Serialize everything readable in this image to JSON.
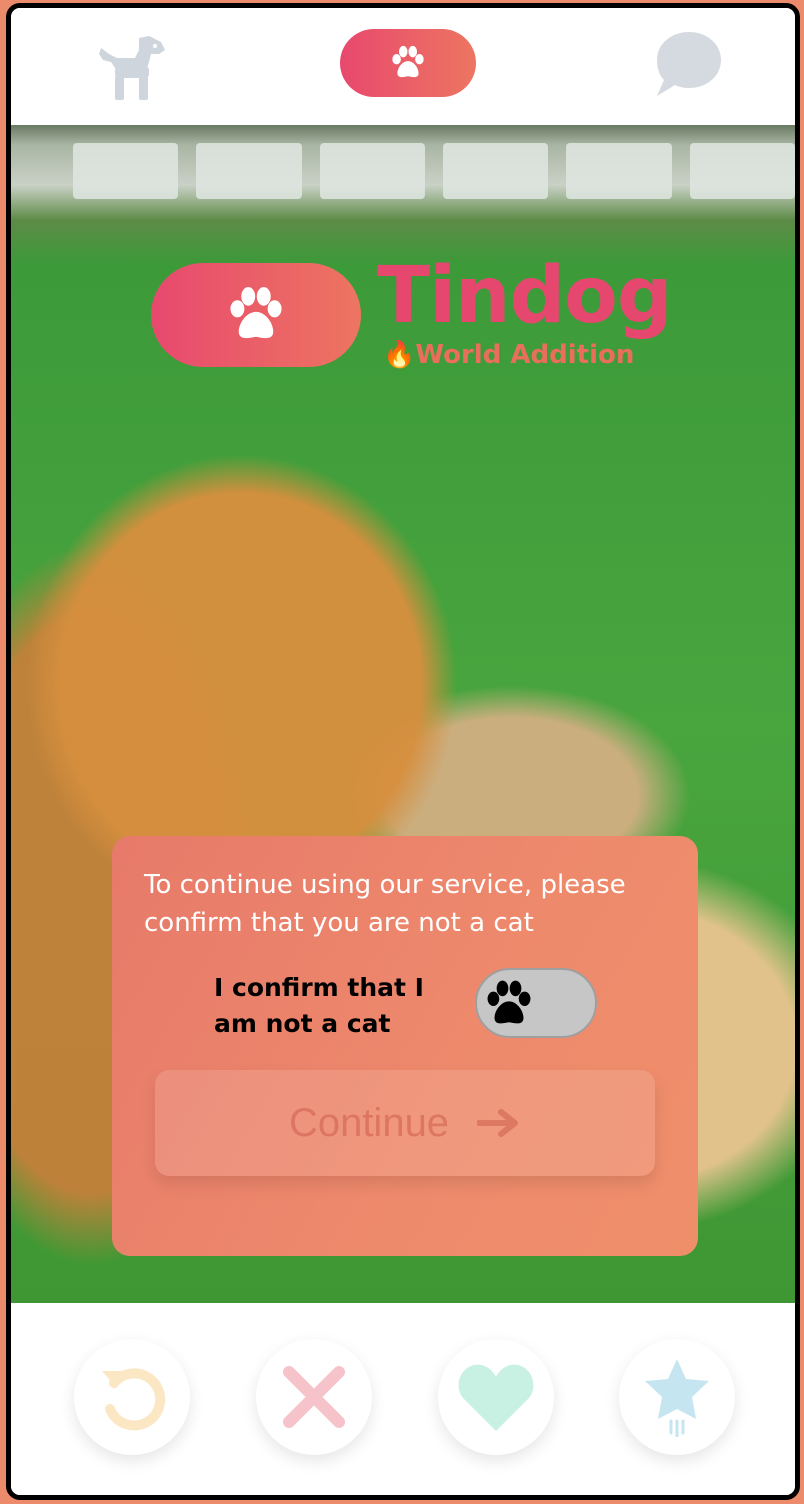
{
  "brand": {
    "name": "Tindog",
    "subtitle_emoji": "🔥",
    "subtitle": "World Addition",
    "color": "#e6476f"
  },
  "nav": {
    "left_icon": "dog-icon",
    "center_icon": "paw-icon",
    "right_icon": "chat-bubble-icon"
  },
  "dialog": {
    "message": "To continue using our service, please confirm that you are not a cat",
    "confirm_label": "I confirm that I am not a cat",
    "toggle_on": false,
    "continue_label": "Continue",
    "continue_icon": "arrow-right-icon"
  },
  "actions": [
    {
      "icon": "undo-icon",
      "color": "#fbe7c4"
    },
    {
      "icon": "close-icon",
      "color": "#f6c3cb"
    },
    {
      "icon": "heart-icon",
      "color": "#c8f1e3"
    },
    {
      "icon": "star-icon",
      "color": "#c5e6f0"
    }
  ]
}
